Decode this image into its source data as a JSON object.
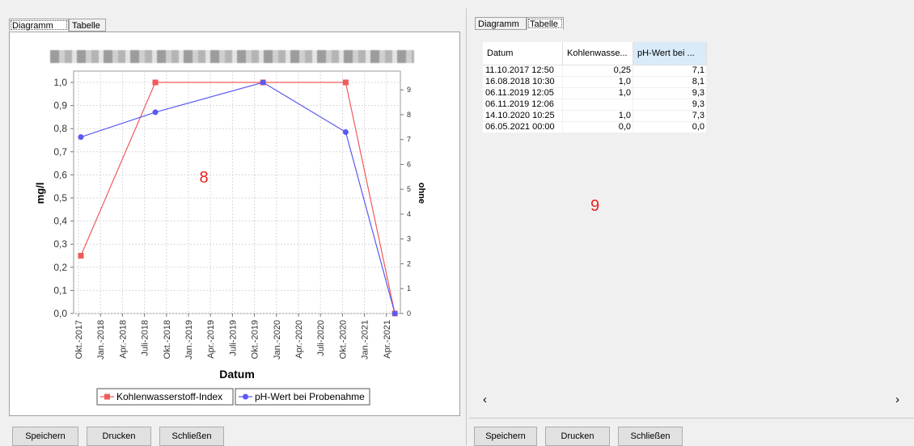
{
  "left": {
    "tabs": [
      "Diagramm",
      "Tabelle"
    ],
    "buttons": {
      "save": "Speichern",
      "print": "Drucken",
      "close": "Schließen"
    },
    "annotation": "8"
  },
  "right": {
    "tabs": [
      "Diagramm",
      "Tabelle"
    ],
    "buttons": {
      "save": "Speichern",
      "print": "Drucken",
      "close": "Schließen"
    },
    "annotation": "9",
    "table": {
      "headers": [
        "Datum",
        "Kohlenwasse...",
        "pH-Wert bei ..."
      ],
      "rows": [
        [
          "11.10.2017 12:50",
          "0,25",
          "7,1"
        ],
        [
          "16.08.2018 10:30",
          "1,0",
          "8,1"
        ],
        [
          "06.11.2019 12:05",
          "1,0",
          "9,3"
        ],
        [
          "06.11.2019 12:06",
          "",
          "9,3"
        ],
        [
          "14.10.2020 10:25",
          "1,0",
          "7,3"
        ],
        [
          "06.05.2021 00:00",
          "0,0",
          "0,0"
        ]
      ]
    },
    "scrollbar": {
      "left_arrow": "‹",
      "right_arrow": "›"
    }
  },
  "colors": {
    "series1": "#f05a5a",
    "series2": "#5a5af0",
    "annotation": "#e8231f"
  },
  "chart_data": {
    "type": "line",
    "title": "",
    "xlabel": "Datum",
    "ylabel": "mg/l",
    "y2label": "ohne",
    "ylim": [
      0,
      1.0
    ],
    "y2lim": [
      0,
      9.3
    ],
    "grid": true,
    "legend_position": "bottom",
    "x_ticks": [
      "Okt.-2017",
      "Jan.-2018",
      "Apr.-2018",
      "Juli-2018",
      "Okt.-2018",
      "Jan.-2019",
      "Apr.-2019",
      "Juli-2019",
      "Okt.-2019",
      "Jan.-2020",
      "Apr.-2020",
      "Juli-2020",
      "Okt.-2020",
      "Jan.-2021",
      "Apr.-2021"
    ],
    "y_ticks": [
      "0,0",
      "0,1",
      "0,2",
      "0,3",
      "0,4",
      "0,5",
      "0,6",
      "0,7",
      "0,8",
      "0,9",
      "1,0"
    ],
    "y2_ticks": [
      "0",
      "1",
      "2",
      "3",
      "4",
      "5",
      "6",
      "7",
      "8",
      "9"
    ],
    "series": [
      {
        "name": "Kohlenwasserstoff-Index",
        "axis": "left",
        "marker": "square",
        "color": "#f05a5a",
        "points": [
          {
            "x": "2017-10-11",
            "y": 0.25
          },
          {
            "x": "2018-08-16",
            "y": 1.0
          },
          {
            "x": "2019-11-06",
            "y": 1.0
          },
          {
            "x": "2020-10-14",
            "y": 1.0
          },
          {
            "x": "2021-05-06",
            "y": 0.0
          }
        ]
      },
      {
        "name": "pH-Wert bei Probenahme",
        "axis": "right",
        "marker": "circle",
        "color": "#5a5af0",
        "points": [
          {
            "x": "2017-10-11",
            "y": 7.1
          },
          {
            "x": "2018-08-16",
            "y": 8.1
          },
          {
            "x": "2019-11-06",
            "y": 9.3
          },
          {
            "x": "2020-10-14",
            "y": 7.3
          },
          {
            "x": "2021-05-06",
            "y": 0.0
          }
        ]
      }
    ]
  }
}
